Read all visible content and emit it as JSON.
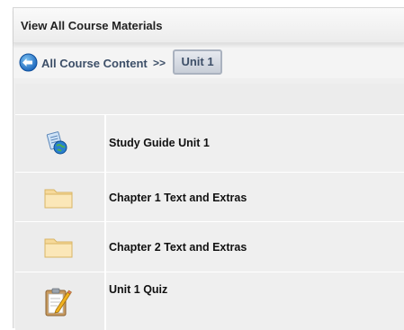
{
  "header": {
    "title": "View All Course Materials"
  },
  "breadcrumb": {
    "root_label": "All Course Content",
    "separator": ">>",
    "current_label": "Unit 1"
  },
  "items": [
    {
      "label": "Study Guide Unit 1",
      "icon": "study-guide-globe-icon"
    },
    {
      "label": "Chapter 1 Text and Extras",
      "icon": "folder-icon"
    },
    {
      "label": "Chapter 2 Text and Extras",
      "icon": "folder-icon"
    },
    {
      "label": "Unit 1 Quiz",
      "icon": "clipboard-pencil-icon"
    }
  ]
}
